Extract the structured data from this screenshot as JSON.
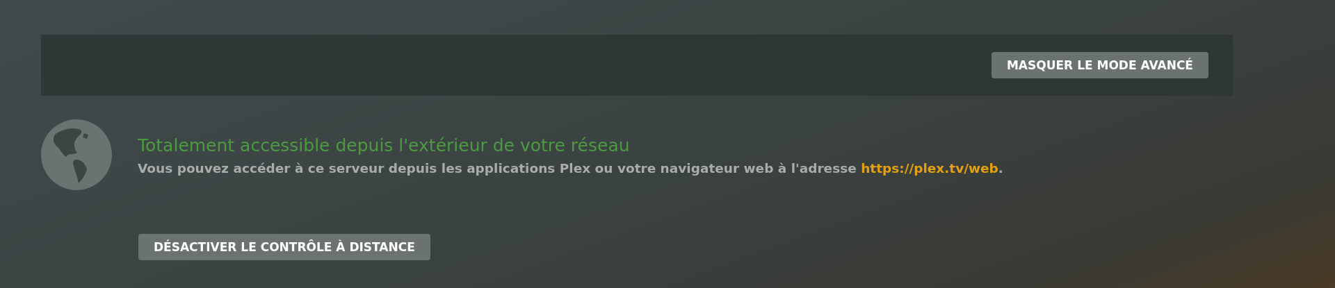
{
  "advanced_bar": {
    "toggle_button": "MASQUER LE MODE AVANCÉ"
  },
  "status": {
    "accessible": true,
    "title": "Totalement accessible depuis l'extérieur de votre réseau",
    "description": "Vous pouvez accéder à ce serveur depuis les applications Plex ou votre navigateur web à l'adresse ",
    "link": "https://plex.tv/web",
    "description_end": "."
  },
  "disable_button": "DÉSACTIVER LE CONTRÔLE À DISTANCE"
}
